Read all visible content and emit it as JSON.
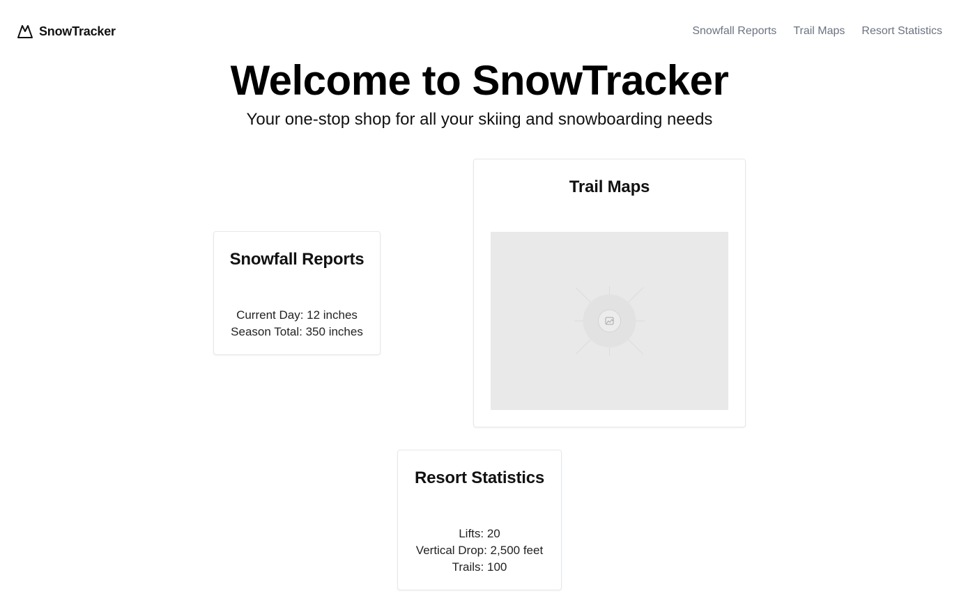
{
  "header": {
    "brand": {
      "name": "SnowTracker",
      "icon": "mountain-icon"
    },
    "nav": [
      {
        "label": "Snowfall Reports"
      },
      {
        "label": "Trail Maps"
      },
      {
        "label": "Resort Statistics"
      }
    ]
  },
  "hero": {
    "title": "Welcome to SnowTracker",
    "subtitle": "Your one-stop shop for all your skiing and snowboarding needs"
  },
  "cards": {
    "snowfall": {
      "title": "Snowfall Reports",
      "lines": [
        "Current Day: 12 inches",
        "Season Total: 350 inches"
      ]
    },
    "trail": {
      "title": "Trail Maps",
      "image_icon": "image-placeholder-icon"
    },
    "resort": {
      "title": "Resort Statistics",
      "lines": [
        "Lifts: 20",
        "Vertical Drop: 2,500 feet",
        "Trails: 100"
      ]
    }
  }
}
